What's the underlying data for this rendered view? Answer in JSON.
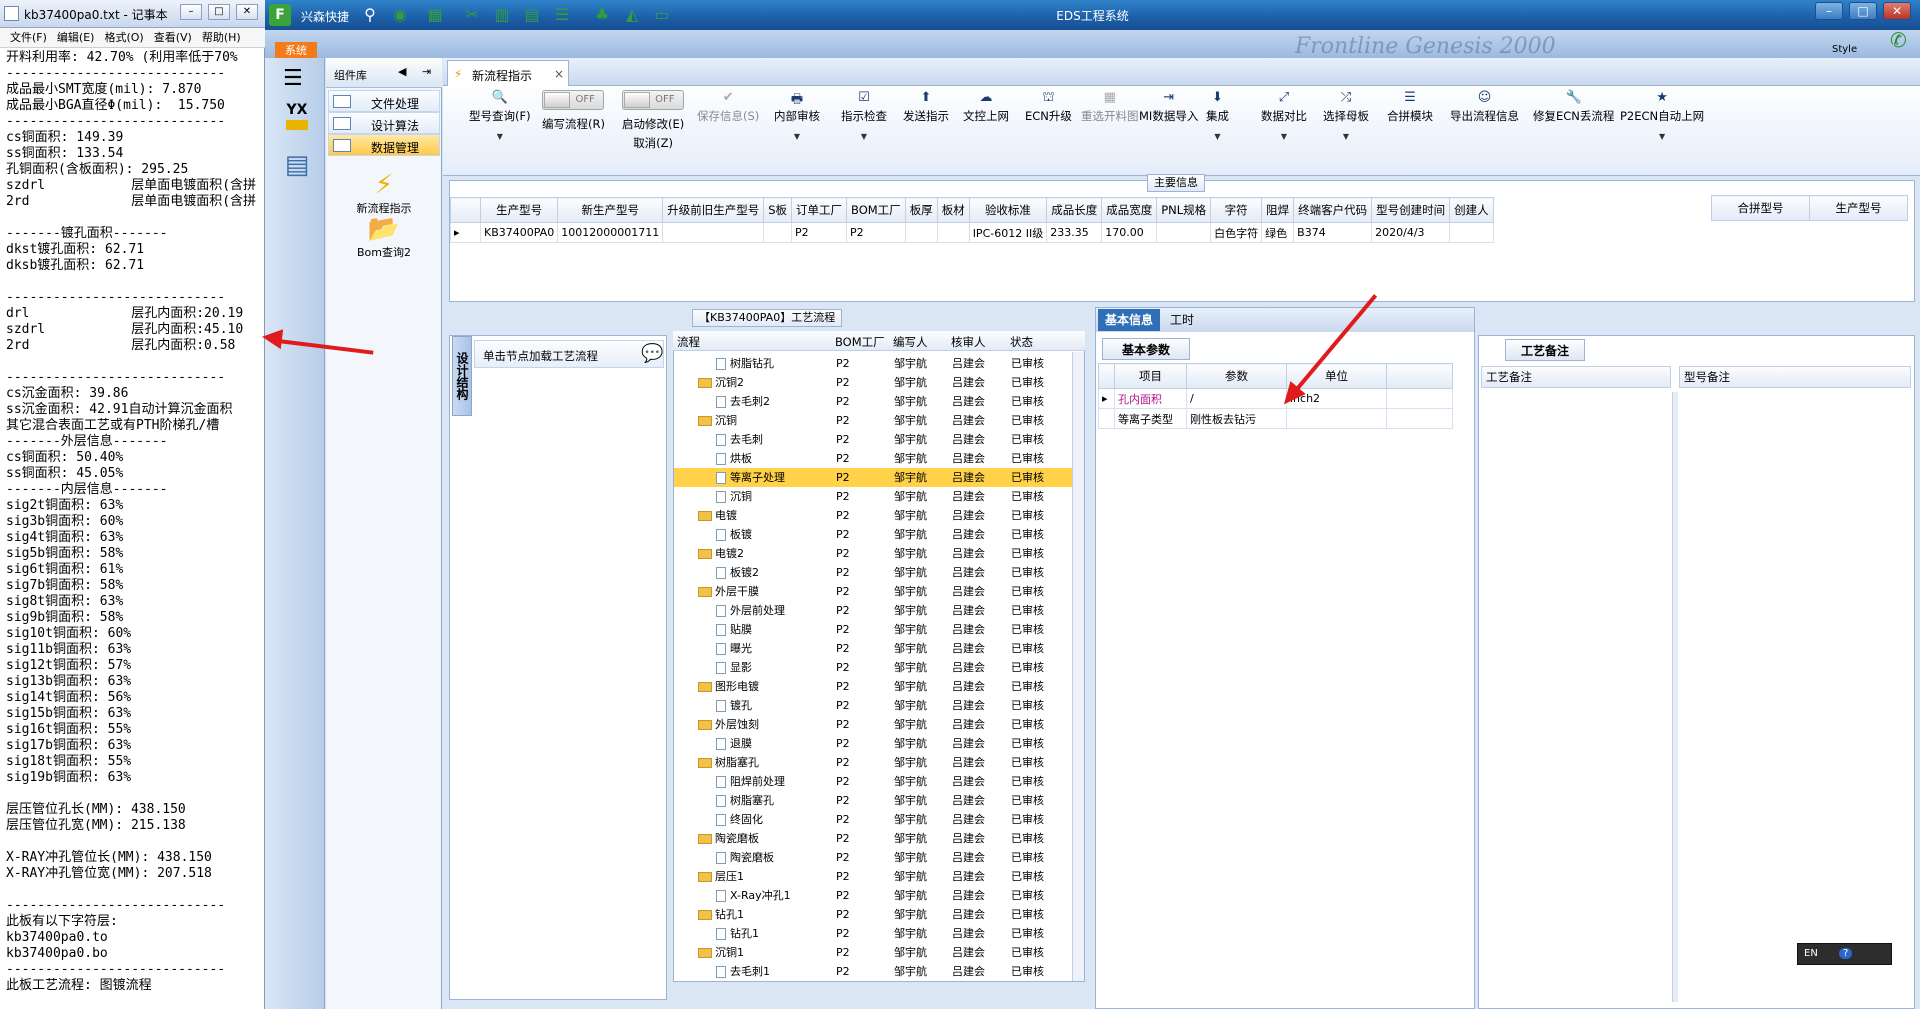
{
  "notepad": {
    "title": "kb37400pa0.txt - 记事本",
    "menu": [
      "文件(F)",
      "编辑(E)",
      "格式(O)",
      "查看(V)",
      "帮助(H)"
    ],
    "lines": [
      "开料利用率: 42.70% (利用率低于70%",
      "----------------------------",
      "成品最小SMT宽度(mil): 7.870",
      "成品最小BGA直径Φ(mil):  15.750",
      "----------------------------",
      "cs铜面积: 149.39",
      "ss铜面积: 133.54",
      "孔铜面积(含板面积): 295.25",
      "szdrl           层单面电镀面积(含拼",
      "2rd             层单面电镀面积(含拼",
      "",
      "-------镀孔面积-------",
      "dkst镀孔面积: 62.71",
      "dksb镀孔面积: 62.71",
      "",
      "----------------------------",
      "drl             层孔内面积:20.19",
      "szdrl           层孔内面积:45.10",
      "2rd             层孔内面积:0.58",
      "",
      "----------------------------",
      "cs沉金面积: 39.86",
      "ss沉金面积: 42.91自动计算沉金面积",
      "其它混合表面工艺或有PTH阶梯孔/槽",
      "-------外层信息-------",
      "cs铜面积: 50.40%",
      "ss铜面积: 45.05%",
      "-------内层信息-------",
      "sig2t铜面积: 63%",
      "sig3b铜面积: 60%",
      "sig4t铜面积: 63%",
      "sig5b铜面积: 58%",
      "sig6t铜面积: 61%",
      "sig7b铜面积: 58%",
      "sig8t铜面积: 63%",
      "sig9b铜面积: 58%",
      "sig10t铜面积: 60%",
      "sig11b铜面积: 63%",
      "sig12t铜面积: 57%",
      "sig13b铜面积: 63%",
      "sig14t铜面积: 56%",
      "sig15b铜面积: 63%",
      "sig16t铜面积: 55%",
      "sig17b铜面积: 63%",
      "sig18t铜面积: 55%",
      "sig19b铜面积: 63%",
      "",
      "层压管位孔长(MM): 438.150",
      "层压管位孔宽(MM): 215.138",
      "",
      "X-RAY冲孔管位长(MM): 438.150",
      "X-RAY冲孔管位宽(MM): 207.518",
      "",
      "----------------------------",
      "此板有以下字符层:",
      "kb37400pa0.to",
      "kb37400pa0.bo",
      "----------------------------",
      "此板工艺流程: 图镀流程"
    ]
  },
  "eds": {
    "title": "EDS工程系统",
    "logo": "F",
    "quick_title": "兴森快捷",
    "sys_tab": "系统",
    "style_label": "Style",
    "deco_brand": "Frontline Genesis 2000",
    "component_lib": "组件库",
    "components": [
      {
        "label": "文件处理"
      },
      {
        "label": "设计算法"
      },
      {
        "label": "数据管理"
      }
    ],
    "big_icons": [
      {
        "label": "新流程指示",
        "glyph": "⚡"
      },
      {
        "label": "Bom查询2",
        "glyph": "📂"
      }
    ],
    "yx_label": "YX",
    "doc_tab": "新流程指示",
    "toolbar": [
      {
        "label": "型号查询(F)",
        "glyph": "🔍",
        "dd": true
      },
      {
        "label": "编写流程(R)",
        "toggle": "OFF"
      },
      {
        "label": "启动修改(E)",
        "label2": "取消(Z)",
        "toggle": "OFF"
      },
      {
        "label": "保存信息(S)",
        "glyph": "✔",
        "dis": true
      },
      {
        "label": "内部审核",
        "glyph": "🖶",
        "dd": true
      },
      {
        "label": "指示检查",
        "glyph": "☑",
        "dd": true
      },
      {
        "label": "发送指示",
        "glyph": "⬆"
      },
      {
        "label": "文控上网",
        "glyph": "☁"
      },
      {
        "label": "ECN升级",
        "glyph": "⛫"
      },
      {
        "label": "重选开料图",
        "glyph": "▦",
        "dis": true
      },
      {
        "label": "MI数据导入",
        "glyph": "⇥"
      },
      {
        "label": "集成",
        "glyph": "⬇",
        "dd": true
      },
      {
        "label": "数据对比",
        "glyph": "⤢",
        "dd": true
      },
      {
        "label": "选择母板",
        "glyph": "⤮",
        "dd": true
      },
      {
        "label": "合拼模块",
        "glyph": "☰"
      },
      {
        "label": "导出流程信息",
        "glyph": "☺"
      },
      {
        "label": "修复ECN丢流程",
        "glyph": "🔧"
      },
      {
        "label": "P2ECN自动上网",
        "glyph": "★",
        "dd": true
      }
    ],
    "main_info_title": "主要信息",
    "main_cols": [
      "生产型号",
      "新生产型号",
      "升级前旧生产型号",
      "S板",
      "订单工厂",
      "BOM工厂",
      "板厚",
      "板材",
      "验收标准",
      "成品长度",
      "成品宽度",
      "PNL规格",
      "字符",
      "阻焊",
      "终端客户代码",
      "型号创建时间",
      "创建人"
    ],
    "main_row": [
      "KB37400PA0",
      "10012000001711",
      "",
      "",
      "P2",
      "P2",
      "",
      "",
      "IPC-6012 II级",
      "233.35",
      "170.00",
      "",
      "白色字符",
      "绿色",
      "B374",
      "2020/4/3",
      ""
    ],
    "side_cols": [
      "合拼型号",
      "生产型号"
    ],
    "process_title": "【KB37400PA0】工艺流程",
    "vtab": "设计结构",
    "flow_hint": "单击节点加载工艺流程",
    "tree_cols": [
      "流程",
      "BOM工厂",
      "编写人",
      "核审人",
      "状态"
    ],
    "tree": [
      {
        "name": "树脂钻孔",
        "lvl": 2,
        "f": "P2",
        "w": "邹宇航",
        "r": "吕建会",
        "s": "已审核"
      },
      {
        "name": "沉铜2",
        "lvl": 1,
        "f": "P2",
        "w": "邹宇航",
        "r": "吕建会",
        "s": "已审核"
      },
      {
        "name": "去毛刺2",
        "lvl": 2,
        "f": "P2",
        "w": "邹宇航",
        "r": "吕建会",
        "s": "已审核"
      },
      {
        "name": "沉铜",
        "lvl": 1,
        "f": "P2",
        "w": "邹宇航",
        "r": "吕建会",
        "s": "已审核"
      },
      {
        "name": "去毛刺",
        "lvl": 2,
        "f": "P2",
        "w": "邹宇航",
        "r": "吕建会",
        "s": "已审核"
      },
      {
        "name": "烘板",
        "lvl": 2,
        "f": "P2",
        "w": "邹宇航",
        "r": "吕建会",
        "s": "已审核"
      },
      {
        "name": "等离子处理",
        "lvl": 2,
        "f": "P2",
        "w": "邹宇航",
        "r": "吕建会",
        "s": "已审核",
        "sel": true
      },
      {
        "name": "沉铜",
        "lvl": 2,
        "f": "P2",
        "w": "邹宇航",
        "r": "吕建会",
        "s": "已审核"
      },
      {
        "name": "电镀",
        "lvl": 1,
        "f": "P2",
        "w": "邹宇航",
        "r": "吕建会",
        "s": "已审核"
      },
      {
        "name": "板镀",
        "lvl": 2,
        "f": "P2",
        "w": "邹宇航",
        "r": "吕建会",
        "s": "已审核"
      },
      {
        "name": "电镀2",
        "lvl": 1,
        "f": "P2",
        "w": "邹宇航",
        "r": "吕建会",
        "s": "已审核"
      },
      {
        "name": "板镀2",
        "lvl": 2,
        "f": "P2",
        "w": "邹宇航",
        "r": "吕建会",
        "s": "已审核"
      },
      {
        "name": "外层干膜",
        "lvl": 1,
        "f": "P2",
        "w": "邹宇航",
        "r": "吕建会",
        "s": "已审核"
      },
      {
        "name": "外层前处理",
        "lvl": 2,
        "f": "P2",
        "w": "邹宇航",
        "r": "吕建会",
        "s": "已审核"
      },
      {
        "name": "贴膜",
        "lvl": 2,
        "f": "P2",
        "w": "邹宇航",
        "r": "吕建会",
        "s": "已审核"
      },
      {
        "name": "曝光",
        "lvl": 2,
        "f": "P2",
        "w": "邹宇航",
        "r": "吕建会",
        "s": "已审核"
      },
      {
        "name": "显影",
        "lvl": 2,
        "f": "P2",
        "w": "邹宇航",
        "r": "吕建会",
        "s": "已审核"
      },
      {
        "name": "图形电镀",
        "lvl": 1,
        "f": "P2",
        "w": "邹宇航",
        "r": "吕建会",
        "s": "已审核"
      },
      {
        "name": "镀孔",
        "lvl": 2,
        "f": "P2",
        "w": "邹宇航",
        "r": "吕建会",
        "s": "已审核"
      },
      {
        "name": "外层蚀刻",
        "lvl": 1,
        "f": "P2",
        "w": "邹宇航",
        "r": "吕建会",
        "s": "已审核"
      },
      {
        "name": "退膜",
        "lvl": 2,
        "f": "P2",
        "w": "邹宇航",
        "r": "吕建会",
        "s": "已审核"
      },
      {
        "name": "树脂塞孔",
        "lvl": 1,
        "f": "P2",
        "w": "邹宇航",
        "r": "吕建会",
        "s": "已审核"
      },
      {
        "name": "阻焊前处理",
        "lvl": 2,
        "f": "P2",
        "w": "邹宇航",
        "r": "吕建会",
        "s": "已审核"
      },
      {
        "name": "树脂塞孔",
        "lvl": 2,
        "f": "P2",
        "w": "邹宇航",
        "r": "吕建会",
        "s": "已审核"
      },
      {
        "name": "终固化",
        "lvl": 2,
        "f": "P2",
        "w": "邹宇航",
        "r": "吕建会",
        "s": "已审核"
      },
      {
        "name": "陶瓷磨板",
        "lvl": 1,
        "f": "P2",
        "w": "邹宇航",
        "r": "吕建会",
        "s": "已审核"
      },
      {
        "name": "陶瓷磨板",
        "lvl": 2,
        "f": "P2",
        "w": "邹宇航",
        "r": "吕建会",
        "s": "已审核"
      },
      {
        "name": "层压1",
        "lvl": 1,
        "f": "P2",
        "w": "邹宇航",
        "r": "吕建会",
        "s": "已审核"
      },
      {
        "name": "X-Ray冲孔1",
        "lvl": 2,
        "f": "P2",
        "w": "邹宇航",
        "r": "吕建会",
        "s": "已审核"
      },
      {
        "name": "钻孔1",
        "lvl": 1,
        "f": "P2",
        "w": "邹宇航",
        "r": "吕建会",
        "s": "已审核"
      },
      {
        "name": "钻孔1",
        "lvl": 2,
        "f": "P2",
        "w": "邹宇航",
        "r": "吕建会",
        "s": "已审核"
      },
      {
        "name": "沉铜1",
        "lvl": 1,
        "f": "P2",
        "w": "邹宇航",
        "r": "吕建会",
        "s": "已审核"
      },
      {
        "name": "去毛刺1",
        "lvl": 2,
        "f": "P2",
        "w": "邹宇航",
        "r": "吕建会",
        "s": "已审核"
      }
    ],
    "basic_tabs": [
      "基本信息",
      "工时"
    ],
    "basic_sub": "基本参数",
    "basic_cols": [
      "项目",
      "参数",
      "单位"
    ],
    "basic_rows": [
      {
        "item": "孔内面积",
        "param": "/",
        "unit": "inch2"
      },
      {
        "item": "等离子类型",
        "param": "刚性板去钻污",
        "unit": ""
      }
    ],
    "notes_tab": "工艺备注",
    "notes_cols": [
      "工艺备注",
      "型号备注"
    ],
    "lang": "EN",
    "colors": {
      "accent": "#2f83c9",
      "selected_row": "#ffd24a",
      "magenta_text": "#b0138c",
      "annotation_arrow": "#e01b1b"
    }
  }
}
